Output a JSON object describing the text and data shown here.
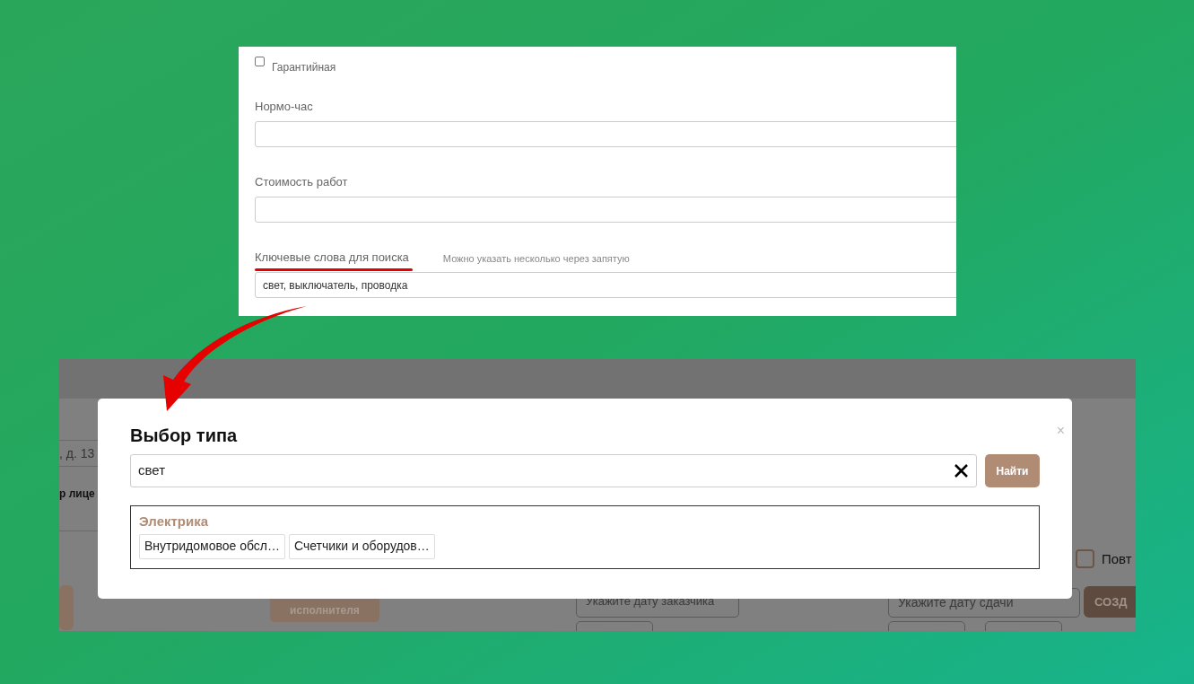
{
  "form_panel": {
    "warranty": {
      "label": "Гарантийная",
      "checked": false
    },
    "fields": [
      {
        "label": "Нормо-час"
      },
      {
        "label": "Стоимость работ"
      },
      {
        "label": "Ключевые слова для поиска",
        "hint": "Можно указать несколько через запятую",
        "value": "свет, выключатель, проводка",
        "highlighted": true
      }
    ]
  },
  "background_app": {
    "address_fragment": ", д. 13",
    "label_fragment": "р лице",
    "executor_button": "исполнителя",
    "repeat_checkbox": {
      "label": "Повт",
      "checked": false
    },
    "customer_date": {
      "placeholder": "Укажите дату заказчика"
    },
    "due_date": {
      "placeholder": "Укажите дату сдачи"
    },
    "create_button": "СОЗД"
  },
  "modal": {
    "title": "Выбор типа",
    "close": "×",
    "search_value": "свет",
    "search_button": "Найти",
    "results": [
      {
        "group": "Электрика",
        "items": [
          "Внутридомовое обсл…",
          "Счетчики и оборудов…"
        ]
      }
    ]
  }
}
